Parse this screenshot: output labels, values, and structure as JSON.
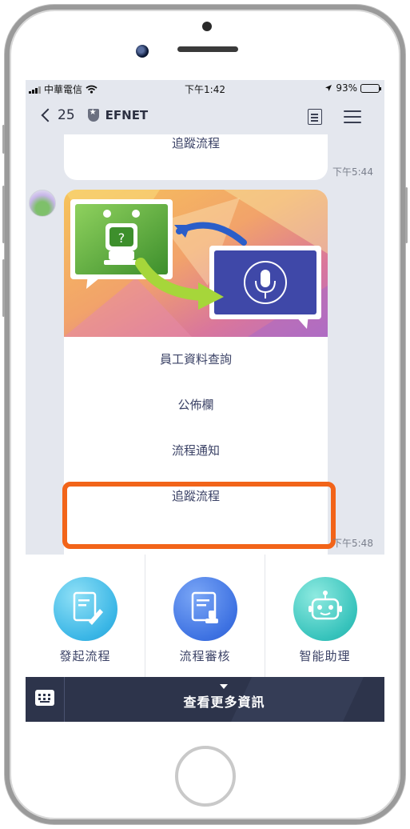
{
  "status_bar": {
    "carrier": "中華電信",
    "time": "下午1:42",
    "battery": "93%",
    "battery_level": 0.93
  },
  "nav": {
    "back_count": "25",
    "chat_name": "EFNET"
  },
  "chat": {
    "previous_card": {
      "last_option": "追蹤流程",
      "timestamp": "下午5:44"
    },
    "menu_card": {
      "options": [
        "員工資料查詢",
        "公佈欄",
        "流程通知",
        "追蹤流程"
      ],
      "highlighted_option": "追蹤流程",
      "timestamp": "下午5:48"
    }
  },
  "action_panel": {
    "items": [
      {
        "label": "發起流程",
        "icon": "edit-document-icon"
      },
      {
        "label": "流程審核",
        "icon": "stamp-document-icon"
      },
      {
        "label": "智能助理",
        "icon": "robot-icon"
      }
    ]
  },
  "bottom_bar": {
    "label": "查看更多資訊",
    "keyboard_icon": "keyboard-icon"
  },
  "colors": {
    "highlight": "#f26419",
    "bottom_bar": "#2d344b",
    "chat_background": "#e4e7ee",
    "text_primary": "#3b4266"
  }
}
